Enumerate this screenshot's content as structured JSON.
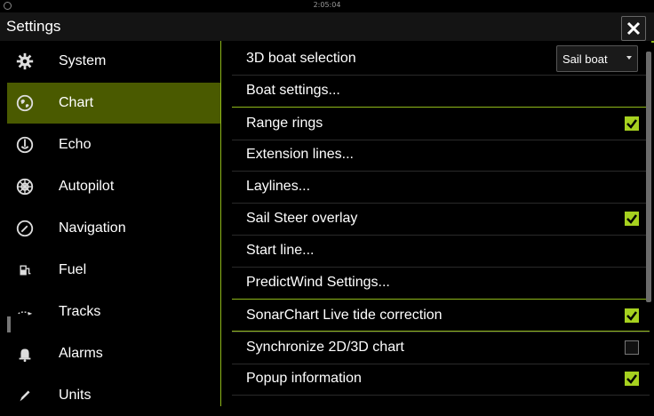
{
  "status": {
    "time": "2:05:04"
  },
  "titlebar": {
    "title": "Settings",
    "close_label": "✕"
  },
  "sidebar": {
    "items": [
      {
        "label": "System",
        "icon": "gear-icon"
      },
      {
        "label": "Chart",
        "icon": "chart-globe-icon",
        "active": true
      },
      {
        "label": "Echo",
        "icon": "echo-icon"
      },
      {
        "label": "Autopilot",
        "icon": "helm-icon"
      },
      {
        "label": "Navigation",
        "icon": "compass-icon"
      },
      {
        "label": "Fuel",
        "icon": "fuel-icon"
      },
      {
        "label": "Tracks",
        "icon": "tracks-icon"
      },
      {
        "label": "Alarms",
        "icon": "bell-icon"
      },
      {
        "label": "Units",
        "icon": "pencil-icon"
      }
    ]
  },
  "chart_settings": {
    "rows": [
      {
        "label": "3D boat selection",
        "control": "dropdown",
        "value": "Sail boat"
      },
      {
        "label": "Boat settings...",
        "control": "none"
      },
      {
        "label": "Range rings",
        "control": "checkbox",
        "checked": true
      },
      {
        "label": "Extension lines...",
        "control": "none"
      },
      {
        "label": "Laylines...",
        "control": "none"
      },
      {
        "label": "Sail Steer overlay",
        "control": "checkbox",
        "checked": true
      },
      {
        "label": "Start line...",
        "control": "none"
      },
      {
        "label": "PredictWind Settings...",
        "control": "none"
      },
      {
        "label": "SonarChart Live tide correction",
        "control": "checkbox",
        "checked": true
      },
      {
        "label": "Synchronize 2D/3D chart",
        "control": "checkbox",
        "checked": false
      },
      {
        "label": "Popup information",
        "control": "checkbox",
        "checked": true
      }
    ]
  },
  "colors": {
    "accent": "#8fb81a",
    "active_bg": "#4a5a00",
    "check": "#a6d11f"
  }
}
